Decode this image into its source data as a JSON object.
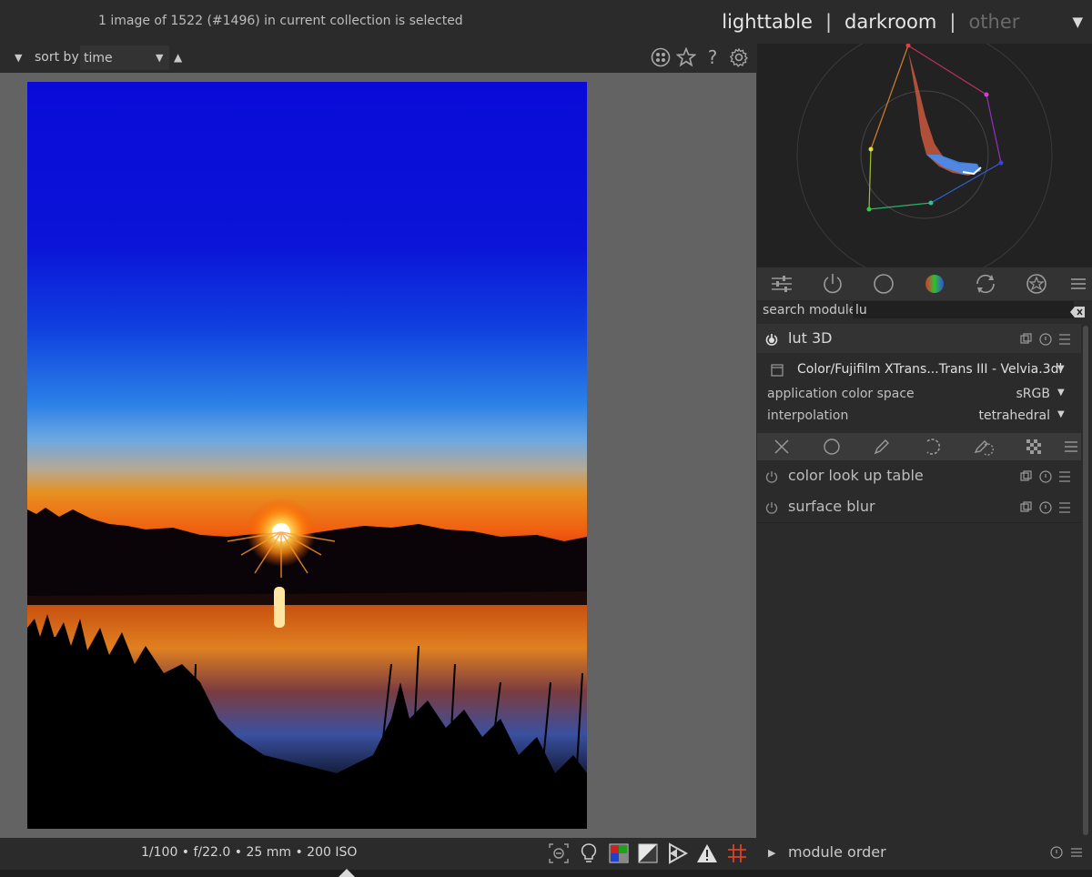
{
  "header": {
    "status": "1 image of 1522 (#1496) in current collection is selected",
    "views": [
      "lighttable",
      "darkroom",
      "other"
    ]
  },
  "toolbar": {
    "sort_label": "sort by",
    "sort_value": "time",
    "icons": [
      "color-labels-icon",
      "star-icon",
      "help-icon",
      "gear-icon"
    ]
  },
  "bottom": {
    "exif": "1/100 • f/22.0 • 25 mm • 200 ISO",
    "icons": [
      "focus-peaking-icon",
      "bulb-icon",
      "color-assessment-icon",
      "raw-overexposed-icon",
      "clipping-icon",
      "gamut-check-icon",
      "guides-icon"
    ]
  },
  "module_groups": [
    "quick-access-icon",
    "active-modules-icon",
    "base-icon",
    "color-icon",
    "correct-icon",
    "effect-icon",
    "presets-menu-icon"
  ],
  "search": {
    "label": "search module",
    "value": "lu"
  },
  "modules": {
    "lut3d": {
      "name": "lut 3D",
      "file": "Color/Fujifilm XTrans...Trans III - Velvia.3dl",
      "rows": [
        {
          "label": "application color space",
          "value": "sRGB"
        },
        {
          "label": "interpolation",
          "value": "tetrahedral"
        }
      ]
    },
    "color_lookup": {
      "name": "color look up table"
    },
    "surface_blur": {
      "name": "surface blur"
    }
  },
  "module_order": {
    "label": "module order"
  },
  "colors": {
    "panel_bg": "#2b2b2b",
    "image_bg": "#636363",
    "module_header_bg": "#333333"
  }
}
